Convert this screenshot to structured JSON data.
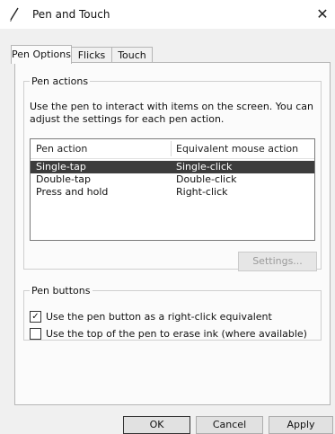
{
  "window": {
    "title": "Pen and Touch",
    "close_glyph": "✕",
    "icon": "pen-icon"
  },
  "tabs": [
    {
      "label": "Pen Options",
      "active": true
    },
    {
      "label": "Flicks",
      "active": false
    },
    {
      "label": "Touch",
      "active": false
    }
  ],
  "pen_actions": {
    "group_label": "Pen actions",
    "description": "Use the pen to interact with items on the screen.  You can adjust the settings for each pen action.",
    "columns": [
      "Pen action",
      "Equivalent mouse action"
    ],
    "rows": [
      {
        "action": "Single-tap",
        "mouse": "Single-click",
        "selected": true
      },
      {
        "action": "Double-tap",
        "mouse": "Double-click",
        "selected": false
      },
      {
        "action": "Press and hold",
        "mouse": "Right-click",
        "selected": false
      }
    ],
    "settings_button": "Settings...",
    "settings_enabled": false
  },
  "pen_buttons": {
    "group_label": "Pen buttons",
    "options": [
      {
        "label": "Use the pen button as a right-click equivalent",
        "checked": true,
        "check_glyph": "✓"
      },
      {
        "label": "Use the top of the pen to erase ink (where available)",
        "checked": false,
        "check_glyph": ""
      }
    ]
  },
  "footer": {
    "ok": "OK",
    "cancel": "Cancel",
    "apply": "Apply"
  }
}
